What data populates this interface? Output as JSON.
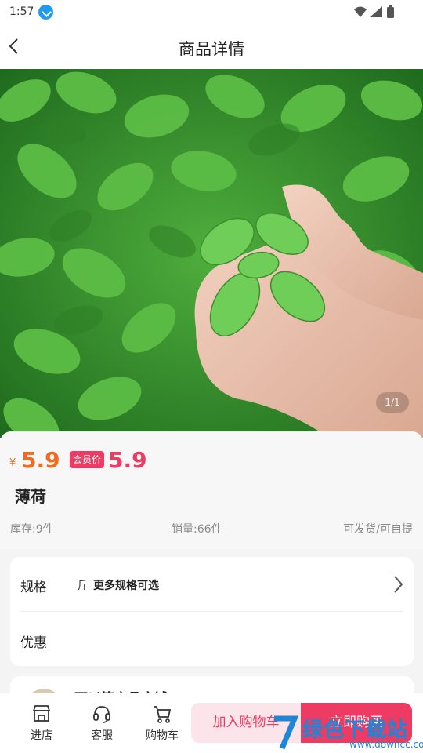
{
  "status_bar": {
    "time": "1:57"
  },
  "header": {
    "title": "商品详情"
  },
  "gallery": {
    "counter": "1/1"
  },
  "product": {
    "currency": "¥",
    "price": "5.9",
    "member_badge": "会员价",
    "member_price": "5.9",
    "name": "薄荷",
    "stock": "库存:9件",
    "sales": "销量:66件",
    "delivery": "可发货/可自提"
  },
  "spec": {
    "label": "规格",
    "unit": "斤",
    "more": "更多规格可选",
    "promo_label": "优惠"
  },
  "shop": {
    "name": "可以签商品店铺"
  },
  "bottom_bar": {
    "store_label": "进店",
    "service_label": "客服",
    "cart_label": "购物车",
    "add_to_cart": "加入购物车",
    "buy_now": "立即购买"
  },
  "watermark": {
    "text": "绿色下载站",
    "url": "www.downcc.com"
  },
  "colors": {
    "price": "#f26a1b",
    "accent": "#ee3b63",
    "leaf": "#4caf3a"
  }
}
